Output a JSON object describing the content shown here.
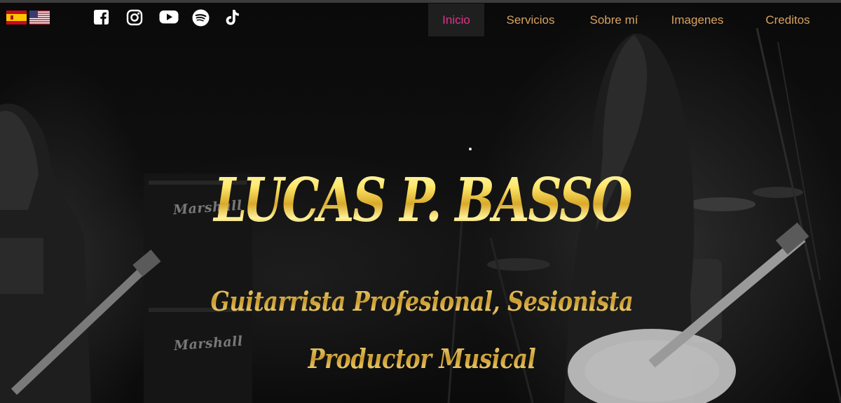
{
  "flags": [
    {
      "name": "spain-flag-icon",
      "country": "Español"
    },
    {
      "name": "usa-flag-icon",
      "country": "English"
    }
  ],
  "social_icons": [
    "facebook-icon",
    "instagram-icon",
    "youtube-icon",
    "spotify-icon",
    "tiktok-icon"
  ],
  "nav": {
    "items": [
      {
        "label": "Inicio",
        "active": true
      },
      {
        "label": "Servicios",
        "active": false
      },
      {
        "label": "Sobre mí",
        "active": false
      },
      {
        "label": "Imagenes",
        "active": false
      },
      {
        "label": "Creditos",
        "active": false
      }
    ]
  },
  "background": {
    "amp_brand": "Marshall"
  },
  "hero": {
    "title": "LUCAS P. BASSO",
    "subtitle_line1": "Guitarrista Profesional, Sesionista",
    "subtitle_line2": "Productor Musical"
  },
  "colors": {
    "nav_text": "#d8a25e",
    "nav_active_text": "#e0338c",
    "nav_active_bg": "#1f1f1f",
    "gold": "#d9a92a"
  }
}
